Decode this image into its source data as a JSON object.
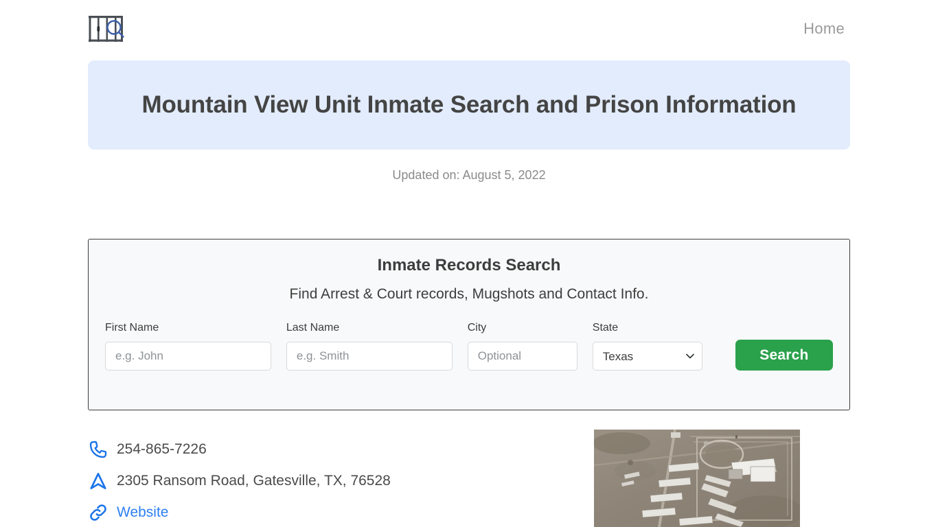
{
  "header": {
    "logo_name": "prison-bars-search-logo",
    "nav": [
      {
        "label": "Home"
      }
    ]
  },
  "banner": {
    "title": "Mountain View Unit Inmate Search and Prison Information",
    "background_color": "#e3ecfc"
  },
  "updated": {
    "text": "Updated on: August 5, 2022"
  },
  "search_card": {
    "title": "Inmate Records Search",
    "subtitle": "Find Arrest & Court records, Mugshots and Contact Info.",
    "fields": {
      "first_name": {
        "label": "First Name",
        "placeholder": "e.g. John",
        "value": ""
      },
      "last_name": {
        "label": "Last Name",
        "placeholder": "e.g. Smith",
        "value": ""
      },
      "city": {
        "label": "City",
        "placeholder": "Optional",
        "value": ""
      },
      "state": {
        "label": "State",
        "selected": "Texas",
        "options": [
          "Texas"
        ]
      }
    },
    "search_button": "Search",
    "search_button_color": "#2aa14b"
  },
  "contact": {
    "phone": "254-865-7226",
    "address": "2305 Ransom Road, Gatesville, TX, 76528",
    "website_label": "Website",
    "icon_color": "#1a73e8",
    "link_color": "#2d7ff0"
  },
  "aerial_photo": {
    "alt": "Satellite aerial view of Mountain View Unit prison facility"
  }
}
